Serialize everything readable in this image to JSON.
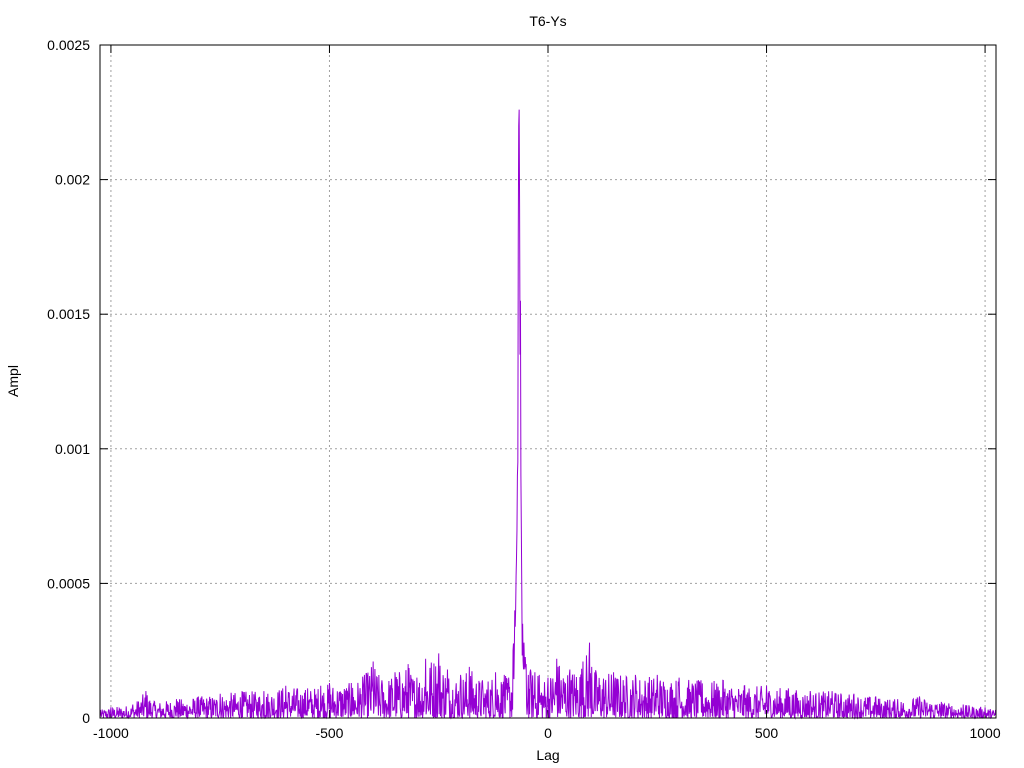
{
  "chart_data": {
    "type": "line",
    "title": "T6-Ys",
    "xlabel": "Lag",
    "ylabel": "Ampl",
    "xlim": [
      -1025,
      1025
    ],
    "ylim": [
      0,
      0.0025
    ],
    "x_ticks": [
      -1000,
      -500,
      0,
      500,
      1000
    ],
    "x_tick_labels": [
      "-1000",
      "-500",
      "0",
      "500",
      "1000"
    ],
    "y_ticks": [
      0,
      0.0005,
      0.001,
      0.0015,
      0.002,
      0.0025
    ],
    "y_tick_labels": [
      "0",
      "0.0005",
      "0.001",
      "0.0015",
      "0.002",
      "0.0025"
    ],
    "grid": true,
    "legend": "none",
    "line_color": "#9400d3",
    "series": [
      {
        "x": [
          -1024,
          -1000,
          -950,
          -920,
          -900,
          -850,
          -800,
          -750,
          -700,
          -650,
          -600,
          -550,
          -520,
          -500,
          -450,
          -420,
          -400,
          -380,
          -350,
          -320,
          -300,
          -280,
          -250,
          -230,
          -200,
          -180,
          -150,
          -120,
          -100,
          -90,
          -80,
          -76,
          -72,
          -70,
          -69,
          -68,
          -67,
          -66,
          -65,
          -64,
          -63,
          -62,
          -61,
          -60,
          -58,
          -55,
          -50,
          -45,
          -40,
          -30,
          -20,
          0,
          20,
          50,
          80,
          95,
          100,
          150,
          200,
          250,
          300,
          350,
          400,
          450,
          500,
          550,
          600,
          650,
          700,
          750,
          800,
          850,
          900,
          950,
          1000,
          1024
        ],
        "y": [
          3e-05,
          4e-05,
          5e-05,
          0.0001,
          6e-05,
          7e-05,
          8e-05,
          9e-05,
          0.0001,
          0.0001,
          0.00012,
          0.00011,
          0.00012,
          0.00013,
          0.00013,
          0.00016,
          0.00021,
          0.00014,
          0.00017,
          0.0002,
          0.00015,
          0.00022,
          0.00024,
          0.00018,
          0.00016,
          0.00019,
          0.00014,
          0.00017,
          0.00016,
          0.00015,
          0.00025,
          0.0004,
          0.0006,
          0.0009,
          0.00095,
          0.0018,
          0.0022,
          0.00226,
          0.0019,
          0.00135,
          0.00155,
          0.0009,
          0.0007,
          0.00048,
          0.00035,
          0.00028,
          0.0002,
          0.00016,
          0.00018,
          0.00017,
          0.00016,
          0.00015,
          0.00022,
          0.00018,
          0.00021,
          0.00028,
          0.00019,
          0.00017,
          0.00016,
          0.00016,
          0.00015,
          0.00014,
          0.00014,
          0.00012,
          0.00012,
          0.00011,
          0.0001,
          0.0001,
          9e-05,
          8e-05,
          7e-05,
          8e-05,
          6e-05,
          5e-05,
          4e-05,
          3e-05
        ]
      }
    ]
  }
}
